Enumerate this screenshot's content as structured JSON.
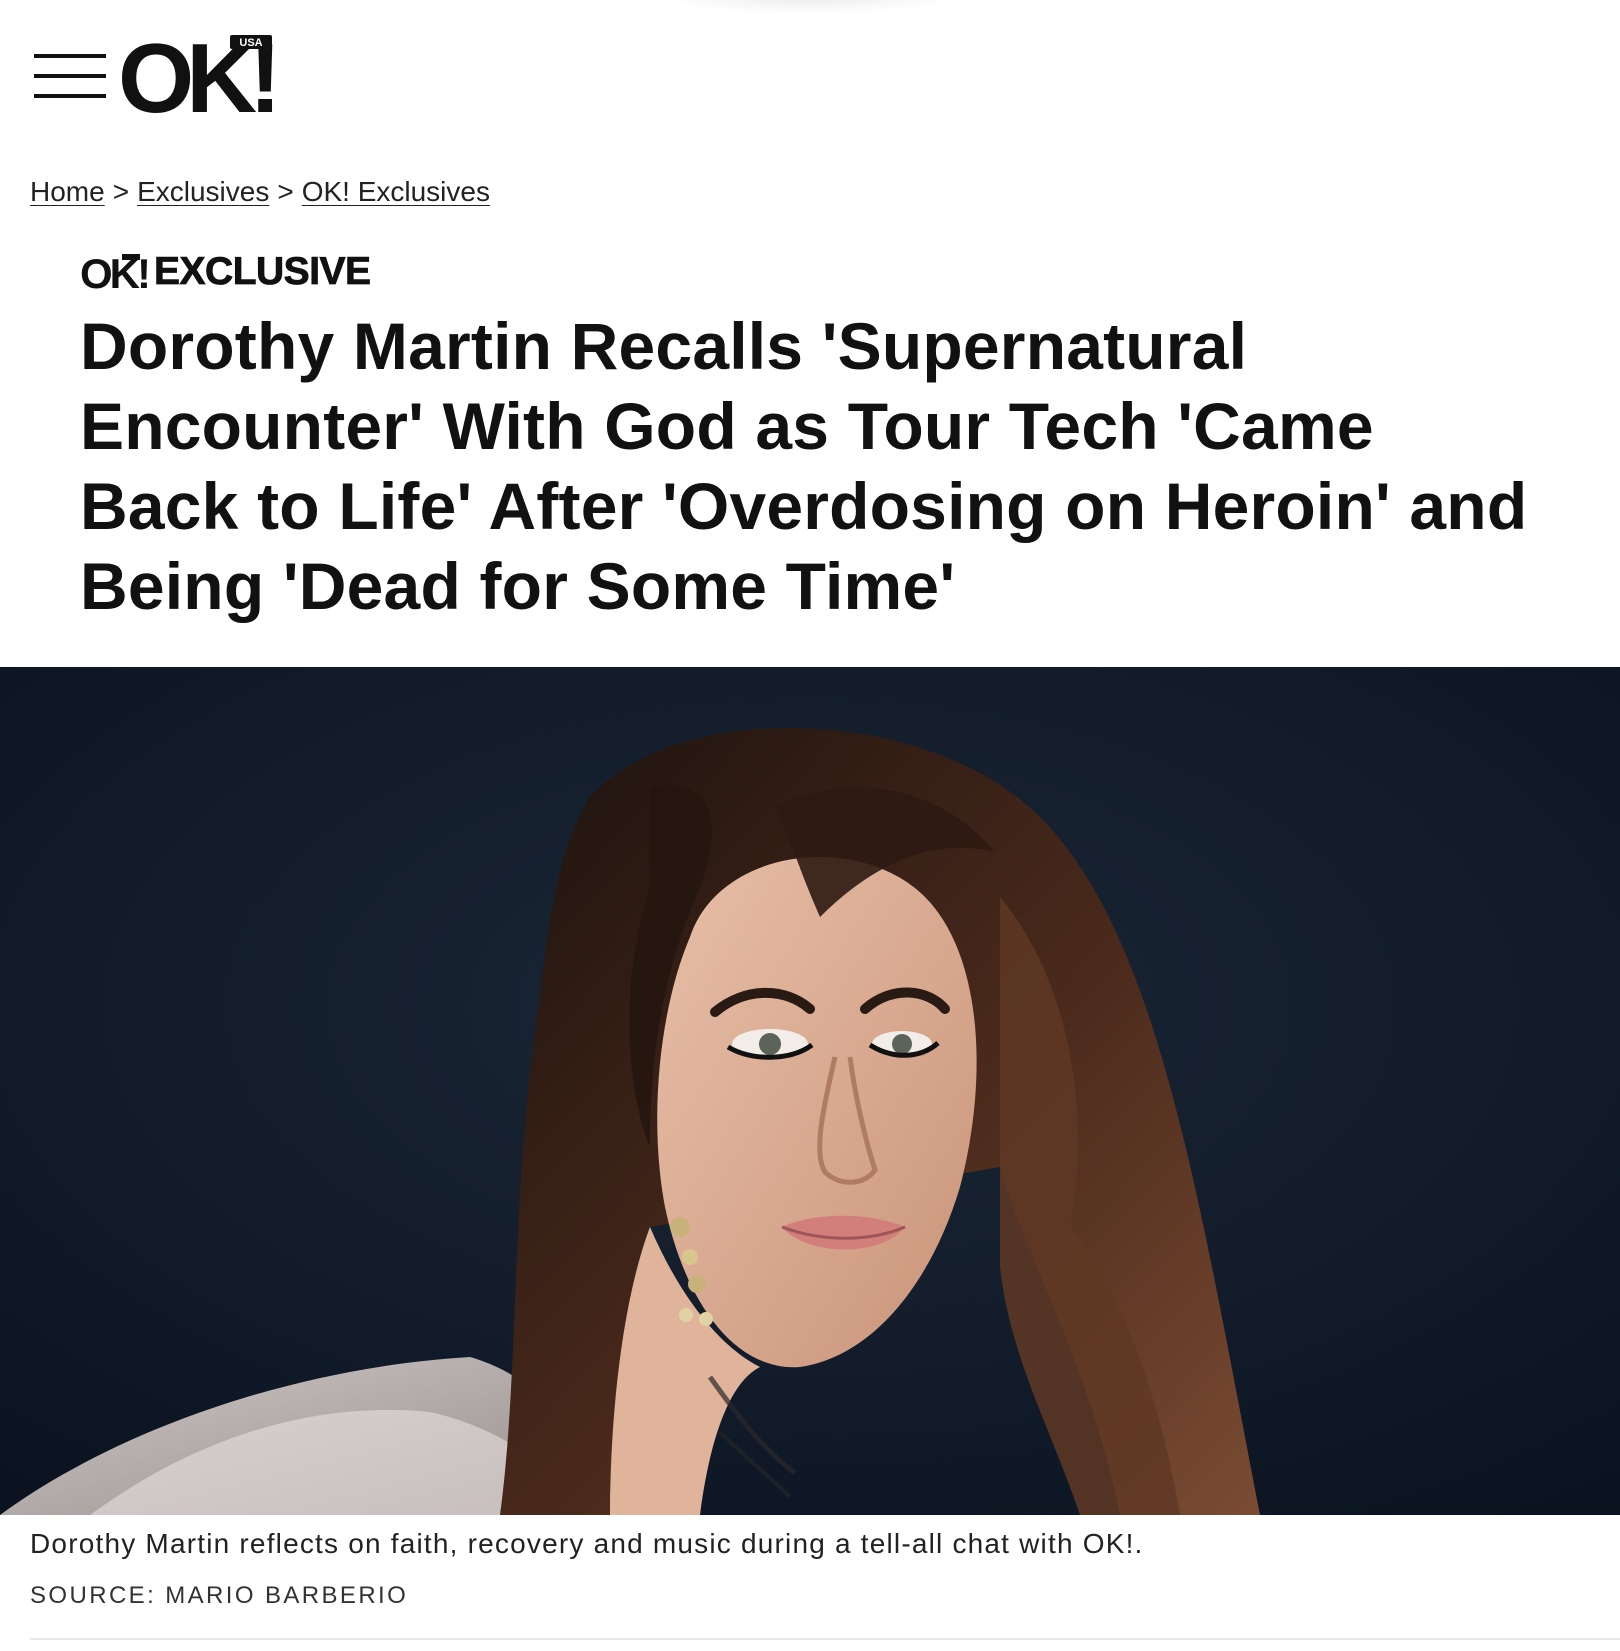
{
  "header": {
    "menu_icon": "hamburger-menu-icon",
    "logo_text": "OK!",
    "logo_region": "USA"
  },
  "breadcrumb": {
    "items": [
      "Home",
      "Exclusives",
      "OK! Exclusives"
    ],
    "separator": ">"
  },
  "article": {
    "badge_logo_text": "OK!",
    "badge_label": "EXCLUSIVE",
    "headline": "Dorothy Martin Recalls 'Supernatural Encounter' With God as Tour Tech 'Came Back to Life' After 'Overdosing on Heroin' and Being 'Dead for Some Time'",
    "caption": "Dorothy Martin reflects on faith, recovery and music during a tell-all chat with OK!.",
    "source": "SOURCE: MARIO BARBERIO"
  },
  "colors": {
    "text": "#111111",
    "hero_background": "#0f1825",
    "divider": "#e8e8e8"
  }
}
